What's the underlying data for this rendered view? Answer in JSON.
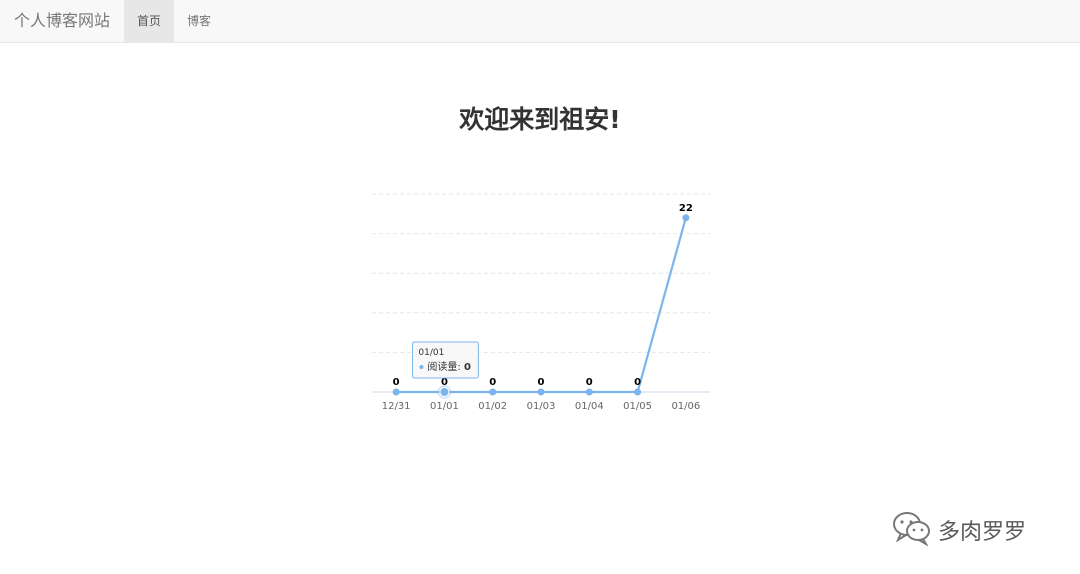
{
  "navbar": {
    "brand": "个人博客网站",
    "items": [
      {
        "label": "首页",
        "active": true
      },
      {
        "label": "博客",
        "active": false
      }
    ]
  },
  "main": {
    "title": "欢迎来到祖安!"
  },
  "chart_data": {
    "type": "line",
    "categories": [
      "12/31",
      "01/01",
      "01/02",
      "01/03",
      "01/04",
      "01/05",
      "01/06"
    ],
    "series": [
      {
        "name": "阅读量",
        "values": [
          0,
          0,
          0,
          0,
          0,
          0,
          22
        ],
        "color": "#7cb5ec"
      }
    ],
    "ylim": [
      0,
      25
    ],
    "grid": true,
    "tooltip": {
      "category": "01/01",
      "series": "阅读量",
      "value": "0"
    }
  },
  "watermark": {
    "text": "多肉罗罗",
    "icon": "wechat-icon"
  }
}
